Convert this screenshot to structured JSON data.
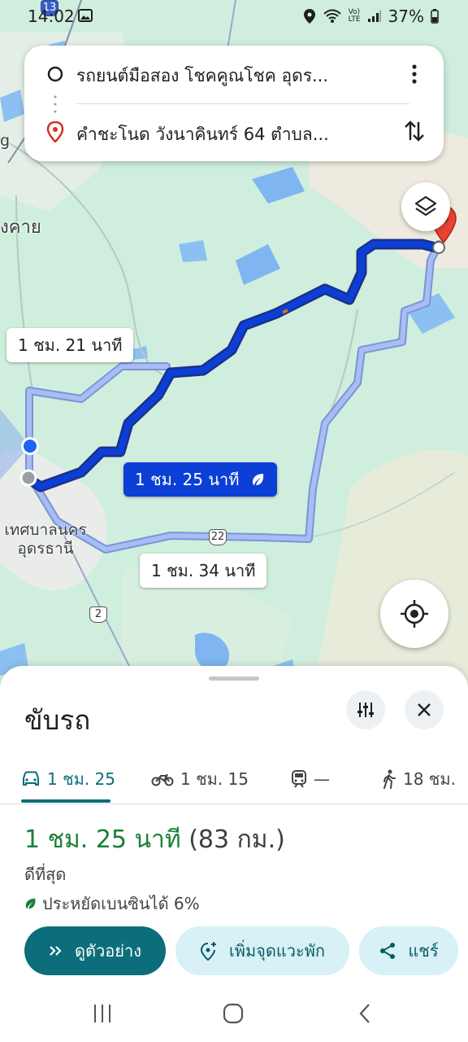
{
  "status": {
    "time": "14:02",
    "battery": "37%"
  },
  "search": {
    "origin": "รถยนต์มือสอง โชคคูณโชค อุดร...",
    "destination": "คำชะโนด วังนาคินทร์ 64 ตำบล..."
  },
  "map": {
    "place_labels": {
      "top_left_fragment": "g",
      "left_fragment": "งคาย",
      "city_line1": "เทศบาลนคร",
      "city_line2": "อุดรธานี"
    },
    "route_shields": {
      "r13": "13",
      "r22": "22",
      "r2": "2"
    },
    "routes": {
      "alt1_time": "1 ชม. 21 นาที",
      "primary_time": "1 ชม. 25 นาที",
      "alt2_time": "1 ชม. 34 นาที"
    },
    "colors": {
      "primary_route": "#0b3fd6",
      "alt_route": "#a7bdf3"
    }
  },
  "sheet": {
    "title": "ขับรถ",
    "modes": [
      {
        "icon": "car-icon",
        "label": "1 ชม. 25"
      },
      {
        "icon": "motorcycle-icon",
        "label": "1 ชม. 15"
      },
      {
        "icon": "train-icon",
        "label": "—"
      },
      {
        "icon": "walk-icon",
        "label": "18 ชม."
      }
    ],
    "result_time": "1 ชม. 25 นาที",
    "result_distance": "(83 กม.)",
    "result_sub": "ดีที่สุด",
    "result_eco": "ประหยัดเบนซินได้ 6%",
    "actions": {
      "preview": "ดูตัวอย่าง",
      "add_stop": "เพิ่มจุดแวะพัก",
      "share": "แชร์"
    }
  },
  "colors": {
    "accent": "#0b6e7a",
    "eta_green": "#188038"
  }
}
